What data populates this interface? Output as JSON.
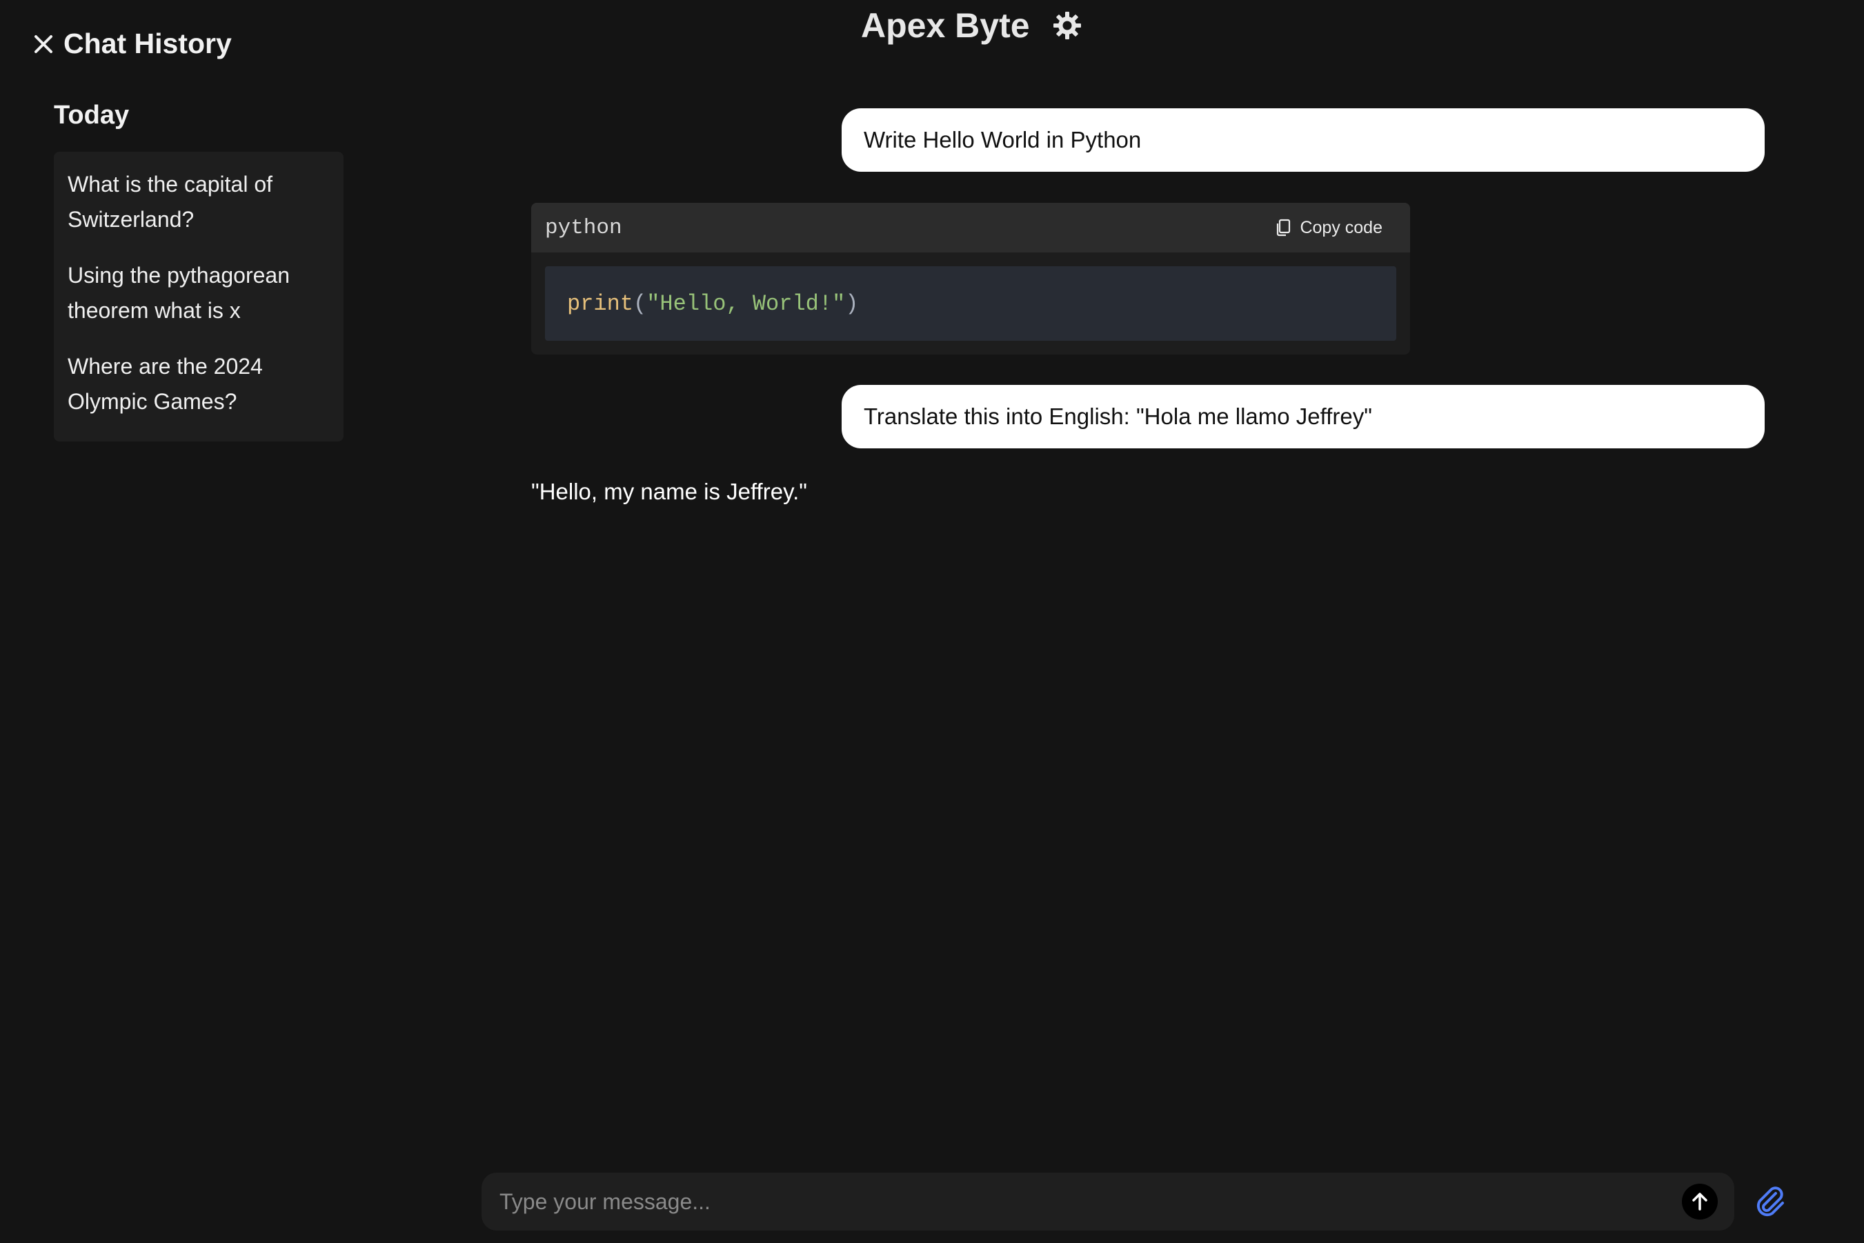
{
  "app": {
    "title": "Apex Byte",
    "theme_icon": "gear-icon"
  },
  "sidebar": {
    "close_icon": "close-icon",
    "title": "Chat History",
    "section_label": "Today",
    "items": [
      {
        "label": "What is the capital of Switzerland?"
      },
      {
        "label": "Using the pythagorean theorem what is x"
      },
      {
        "label": "Where are the 2024 Olympic Games?"
      }
    ]
  },
  "messages": {
    "user_1": "Write Hello World in Python",
    "code_block": {
      "language": "python",
      "copy_label": "Copy code",
      "tokens": {
        "fn": "print",
        "open": "(",
        "str": "\"Hello, World!\"",
        "close": ")"
      }
    },
    "user_2": "Translate this into English: \"Hola me llamo Jeffrey\"",
    "assistant_2": "\"Hello, my name is Jeffrey.\""
  },
  "composer": {
    "placeholder": "Type your message...",
    "value": "",
    "send_icon": "arrow-up-icon",
    "attach_icon": "paperclip-icon"
  },
  "colors": {
    "background": "#141414",
    "sidebar_card": "#1e1e1e",
    "user_bubble": "#ffffff",
    "code_header": "#2c2c2c",
    "code_body": "#282c34",
    "attach_accent": "#4f7cf7"
  }
}
